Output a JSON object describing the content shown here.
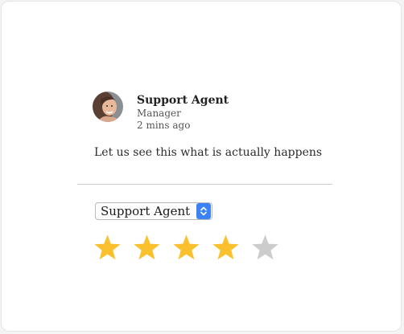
{
  "comment": {
    "author": "Support Agent",
    "role": "Manager",
    "time_ago": "2 mins ago",
    "text": "Let us see this what is actually happens"
  },
  "assignee_select": {
    "selected": "Support Agent"
  },
  "rating": {
    "value": 4,
    "max": 5,
    "filled_color": "#fbc02d",
    "empty_color": "#cccccc"
  },
  "icons": {
    "avatar": "user-avatar-photo",
    "select_arrow": "updown-chevron-icon",
    "star": "star-icon"
  }
}
